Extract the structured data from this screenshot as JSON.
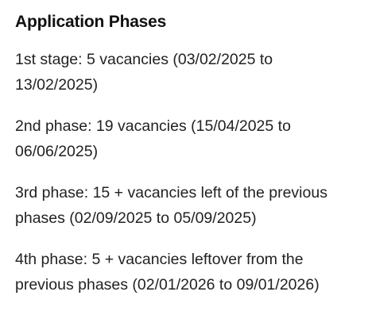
{
  "section": {
    "title": "Application Phases",
    "phases": [
      {
        "text": "1st stage: 5 vacancies (03/02/2025 to 13/02/2025)"
      },
      {
        "text": "2nd phase: 19 vacancies (15/04/2025 to 06/06/2025)"
      },
      {
        "text": "3rd phase: 15 + vacancies left of the previous phases (02/09/2025 to 05/09/2025)"
      },
      {
        "text": "4th phase: 5 + vacancies leftover from the previous phases (02/01/2026 to 09/01/2026)"
      }
    ]
  }
}
